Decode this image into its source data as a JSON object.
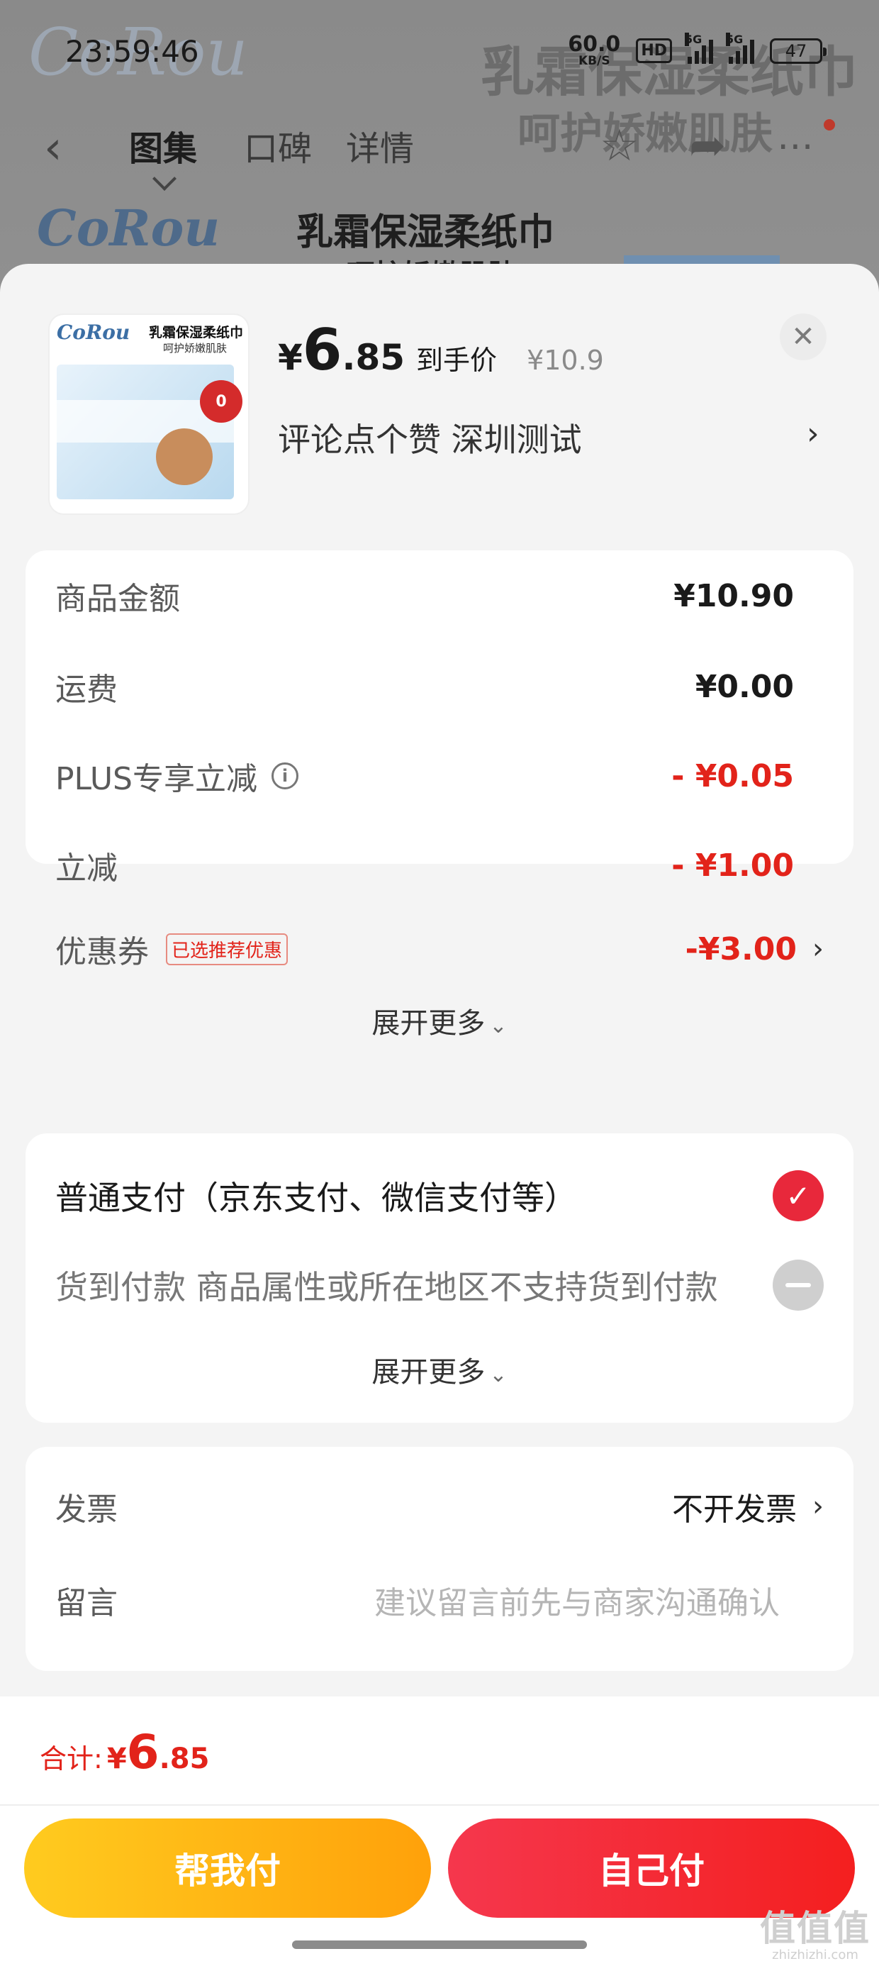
{
  "status_bar": {
    "time": "23:59:46",
    "net_speed": "60.0",
    "net_unit": "KB/S",
    "hd_label": "HD",
    "sig1_label": "5G",
    "sig2_label": "5G",
    "battery": "47"
  },
  "background": {
    "brand_logo": "CoRou",
    "headline_1": "乳霜保湿柔纸巾",
    "headline_2": "呵护娇嫩肌肤",
    "nav_tabs": [
      "图集",
      "口碑",
      "详情"
    ],
    "product_title": "乳霜保湿柔纸巾",
    "product_subtitle": "呵护娇嫩肌肤"
  },
  "product": {
    "thumb_title": "乳霜保湿柔纸巾",
    "thumb_subtitle": "呵护娇嫩肌肤",
    "thumb_logo": "CoRou",
    "thumb_badge": "0",
    "currency": "¥",
    "price_int": "6",
    "price_dec": ".85",
    "price_label": "到手价",
    "original_price": "¥10.9",
    "promo_text": "评论点个赞  深圳测试"
  },
  "summary": {
    "rows": [
      {
        "label": "商品金额",
        "value": "¥10.90"
      },
      {
        "label": "运费",
        "value": "¥0.00"
      },
      {
        "label": "PLUS专享立减",
        "value": "- ¥0.05"
      },
      {
        "label": "立减",
        "value": "- ¥1.00"
      },
      {
        "label": "优惠券",
        "value": "-¥3.00",
        "tag": "已选推荐优惠"
      }
    ],
    "expand_label": "展开更多"
  },
  "payment": {
    "option_1": "普通支付（京东支付、微信支付等）",
    "option_2": "货到付款 商品属性或所在地区不支持货到付款",
    "expand_label": "展开更多"
  },
  "extra": {
    "invoice_label": "发票",
    "invoice_value": "不开发票",
    "note_label": "留言",
    "note_placeholder": "建议留言前先与商家沟通确认"
  },
  "footer": {
    "total_label": "合计:",
    "total_currency": "¥",
    "total_int": "6",
    "total_dec": ".85",
    "help_pay": "帮我付",
    "self_pay": "自己付",
    "watermark": "值值值",
    "watermark_url": "zhizhizhi.com"
  },
  "colors": {
    "accent_red": "#e2231a",
    "button_yellow": "#ffb212",
    "button_red": "#f4293a"
  }
}
